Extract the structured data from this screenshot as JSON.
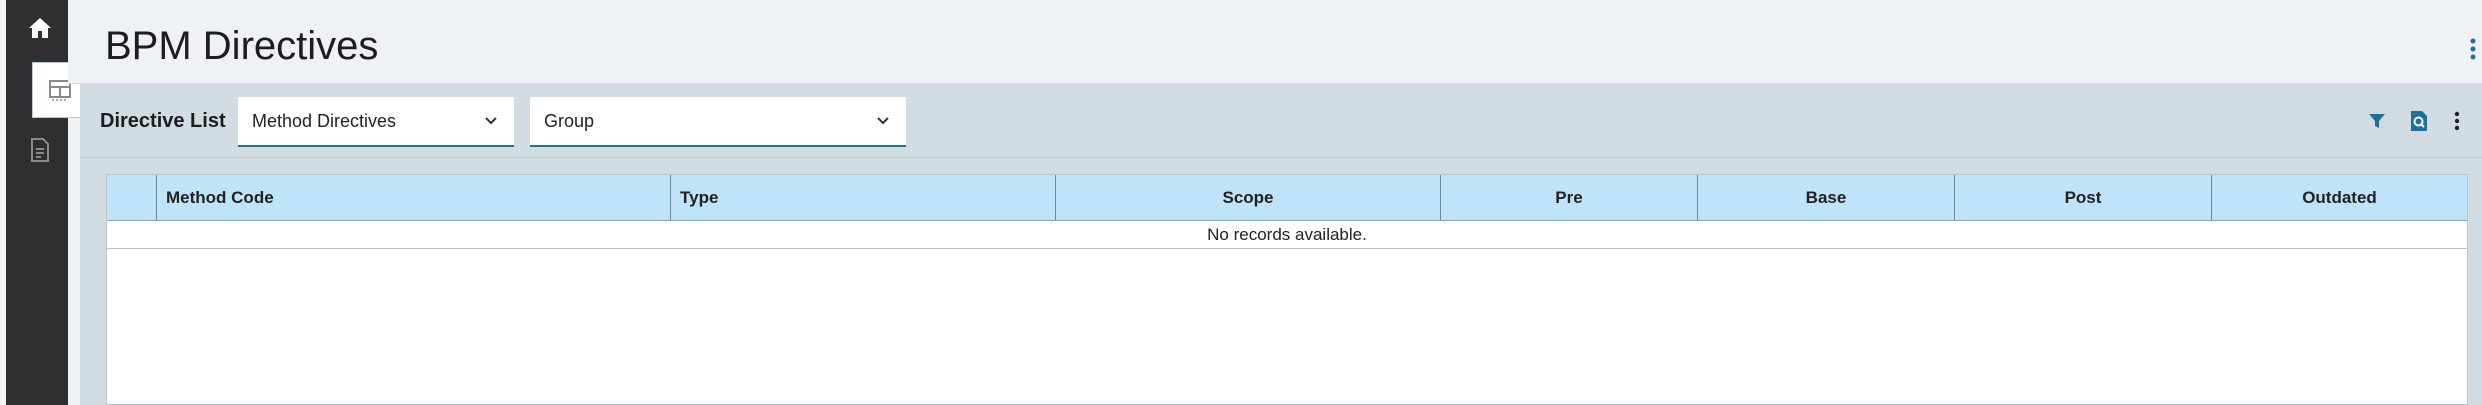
{
  "app": {
    "title": "BPM Directives"
  },
  "rail": {
    "items": [
      {
        "icon": "home-icon"
      },
      {
        "icon": "grid-icon"
      },
      {
        "icon": "document-icon"
      }
    ]
  },
  "panel": {
    "title": "Directive List",
    "method_select": {
      "value": "Method Directives"
    },
    "group_select": {
      "value": "Group"
    }
  },
  "grid": {
    "columns": [
      "",
      "Method Code",
      "Type",
      "Scope",
      "Pre",
      "Base",
      "Post",
      "Outdated"
    ],
    "empty_message": "No records available.",
    "rows": []
  },
  "colors": {
    "accent": "#1f6f9a",
    "rail": "#2f2f31",
    "header_bg": "#bfe3f8",
    "panel_bg": "#d0dce2"
  }
}
